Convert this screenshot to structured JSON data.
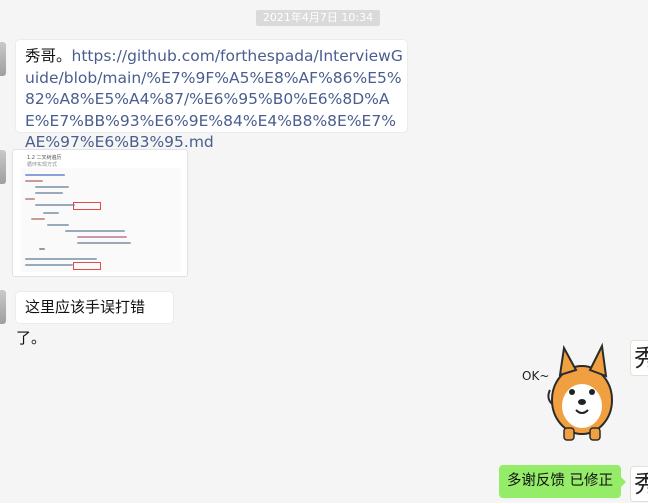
{
  "timestamp": "2021年4月7日 10:34",
  "messages": {
    "first": {
      "prefix": "秀哥。",
      "link": "https://github.com/forthespada/InterviewGuide/blob/main/%E7%9F%A5%E8%AF%86%E5%82%A8%E5%A4%87/%E6%95%B0%E6%8D%AE%E7%BB%93%E6%9E%84%E4%B8%8E%E7%AE%97%E6%B3%95.md"
    },
    "screenshot": {
      "title": "1.2 二叉树遍历",
      "subtitle": "循环实现方式"
    },
    "second": "这里应该手误打错了。",
    "sticker_text": "OK~",
    "reply": "多谢反馈 已修正"
  },
  "avatar_right_glyph": "秀"
}
